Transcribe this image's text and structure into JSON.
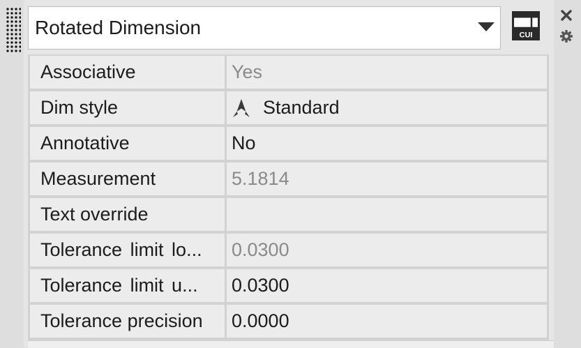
{
  "header": {
    "object_type": "Rotated Dimension"
  },
  "toolbar": {
    "cui_label": "CUI"
  },
  "properties": [
    {
      "label": "Associative",
      "value": "Yes",
      "readonly": true
    },
    {
      "label": "Dim style",
      "value": "Standard",
      "readonly": false,
      "icon": "dimension-style-icon"
    },
    {
      "label": "Annotative",
      "value": "No",
      "readonly": false
    },
    {
      "label": "Measurement",
      "value": "5.1814",
      "readonly": true
    },
    {
      "label": "Text override",
      "value": "",
      "readonly": false
    },
    {
      "label": "Tolerance limit lo...",
      "value": "0.0300",
      "readonly": true
    },
    {
      "label": "Tolerance limit u...",
      "value": "0.0300",
      "readonly": false
    },
    {
      "label": "Tolerance precision",
      "value": "0.0000",
      "readonly": false
    }
  ],
  "colors": {
    "panel": "#e6e6e6",
    "cell": "#ececec",
    "text": "#1c1c1c",
    "readonly_text": "#8a8a8a"
  }
}
